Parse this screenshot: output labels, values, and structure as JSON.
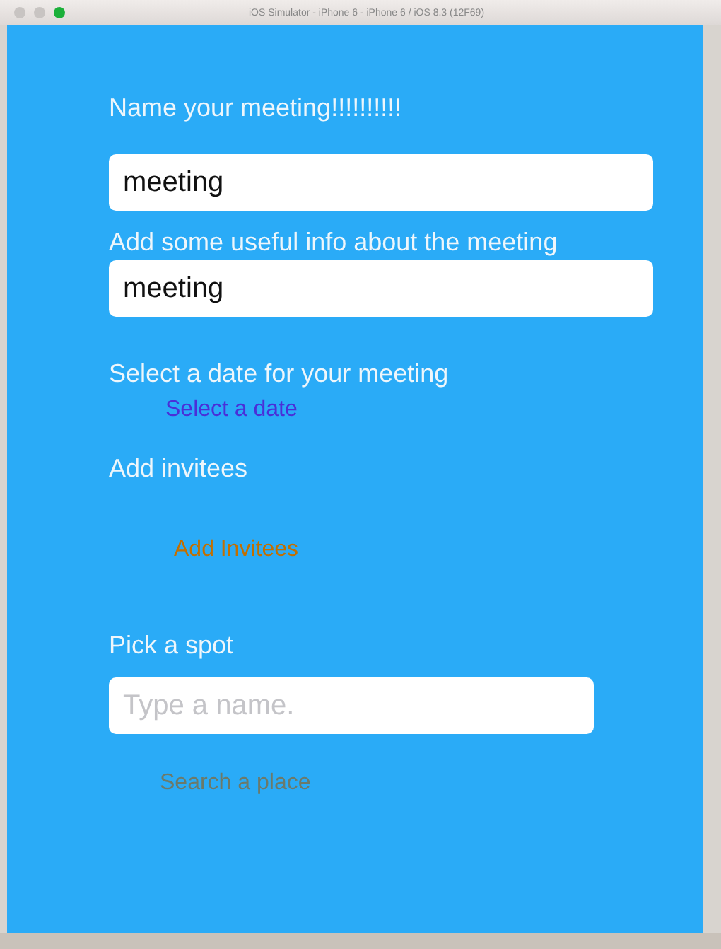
{
  "window": {
    "title": "iOS Simulator - iPhone 6 - iPhone 6 / iOS 8.3 (12F69)"
  },
  "form": [
    {
      "kind": "label",
      "text": "Name your meeting!!!!!!!!!!"
    },
    {
      "kind": "field",
      "value": "meeting"
    },
    {
      "kind": "label",
      "text": "Add some useful info about the meeting"
    },
    {
      "kind": "field",
      "value": "meeting"
    },
    {
      "kind": "label",
      "text": "Select a date for your meeting"
    },
    {
      "kind": "link",
      "text": "Select a date",
      "color": "#4a2fd8"
    },
    {
      "kind": "label",
      "text": "Add invitees"
    },
    {
      "kind": "link",
      "text": "Add Invitees",
      "color": "#c26f00"
    },
    {
      "kind": "label",
      "text": "Pick a spot"
    },
    {
      "kind": "short-field",
      "placeholder": "Type a name."
    },
    {
      "kind": "link",
      "text": "Search a place",
      "color": "#6b7a6a"
    }
  ]
}
